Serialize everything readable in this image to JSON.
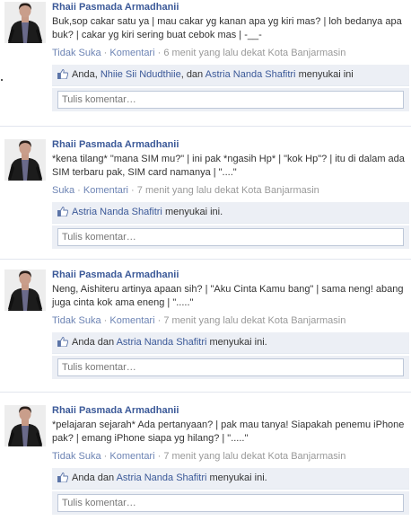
{
  "feed": {
    "comment_placeholder": "Tulis komentar…",
    "posts": [
      {
        "author": "",
        "message": "Buk,sop cakar satu ya | mau cakar yg kanan apa yg kiri mas? | loh bedanya apa buk? | cakar yg kiri sering buat cebok mas | -__-",
        "like_action": "Tidak Suka",
        "comment_action": "Komentari",
        "time": "6 menit yang lalu dekat Kota Banjarmasin",
        "likes_prefix": "Anda, ",
        "likers": [
          "Nhiie Sii Ndudthiie",
          "Astria Nanda Shafitri"
        ],
        "likes_mid": ", dan ",
        "likes_suffix": " menyukai ini"
      },
      {
        "author": "Rhaii Pasmada Armadhanii",
        "message": "*kena tilang* \"mana SIM mu?\" | ini pak *ngasih Hp* | \"kok Hp\"? | itu di dalam ada SIM terbaru pak, SIM card namanya | \"....\"",
        "like_action": "Suka",
        "comment_action": "Komentari",
        "time": "7 menit yang lalu dekat Kota Banjarmasin",
        "likes_prefix": "",
        "likers": [
          "Astria Nanda Shafitri"
        ],
        "likes_suffix": " menyukai ini."
      },
      {
        "author": "Rhaii Pasmada Armadhanii",
        "message": "Neng, Aishiteru artinya apaan sih? | \"Aku Cinta Kamu bang\" | sama neng! abang juga cinta kok ama eneng | \".....\"",
        "like_action": "Tidak Suka",
        "comment_action": "Komentari",
        "time": "7 menit yang lalu dekat Kota Banjarmasin",
        "likes_prefix": "Anda dan ",
        "likers": [
          "Astria Nanda Shafitri"
        ],
        "likes_suffix": " menyukai ini."
      },
      {
        "author": "Rhaii Pasmada Armadhanii",
        "message": "*pelajaran sejarah* Ada pertanyaan? | pak mau tanya! Siapakah penemu iPhone pak? | emang iPhone siapa yg hilang? | \".....\"",
        "like_action": "Tidak Suka",
        "comment_action": "Komentari",
        "time": "7 menit yang lalu dekat Kota Banjarmasin",
        "likes_prefix": "Anda dan ",
        "likers": [
          "Astria Nanda Shafitri"
        ],
        "likes_suffix": " menyukai ini."
      }
    ],
    "first_post_author": "Rhaii Pasmada Armadhanii",
    "separator": " · "
  }
}
